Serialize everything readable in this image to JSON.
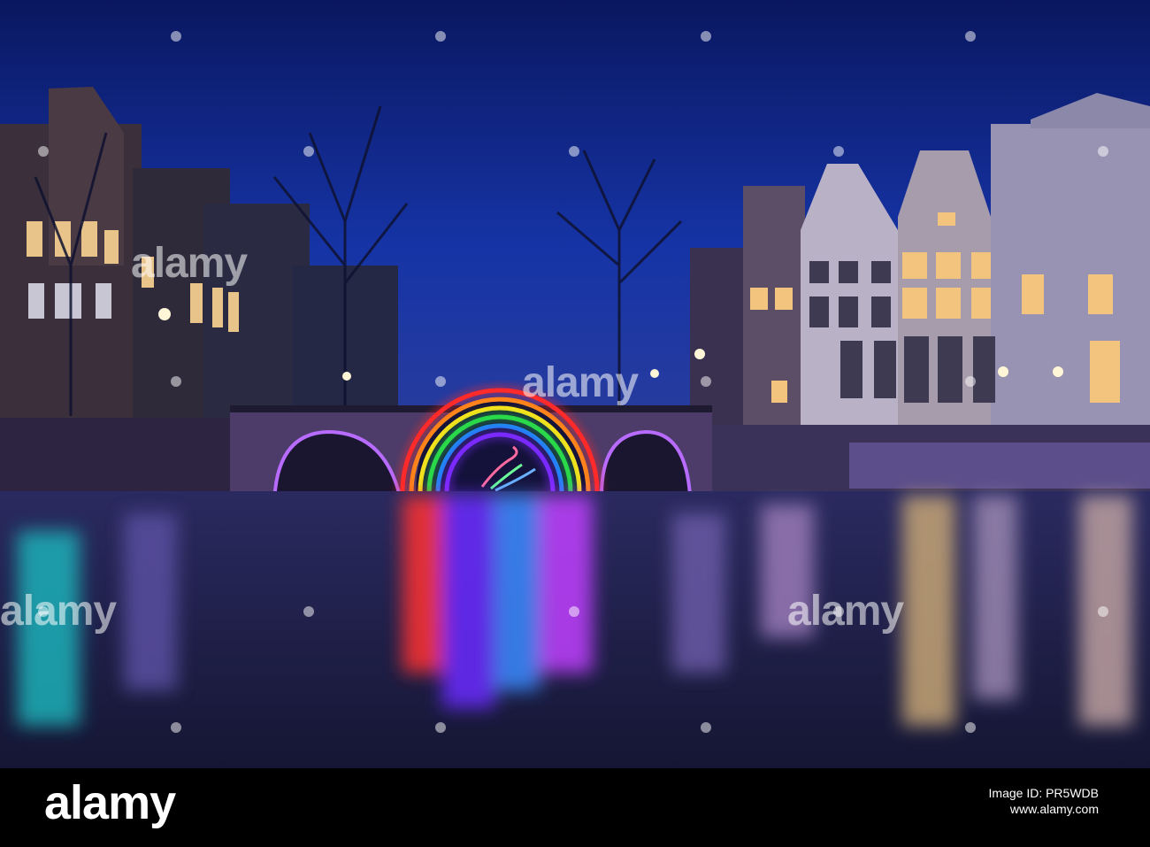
{
  "watermark": {
    "text": "alamy"
  },
  "footer": {
    "logo": "alamy",
    "image_id": "Image ID: PR5WDB",
    "url": "www.alamy.com"
  },
  "colors": {
    "sky_top": "#0b1a5e",
    "sky_mid": "#1b3aa8",
    "water": "#1f2348",
    "rainbow": [
      "#ff2a2a",
      "#ff8a1a",
      "#ffe21a",
      "#2ad94a",
      "#1a7aff",
      "#7a2aff",
      "#d42aff"
    ]
  }
}
